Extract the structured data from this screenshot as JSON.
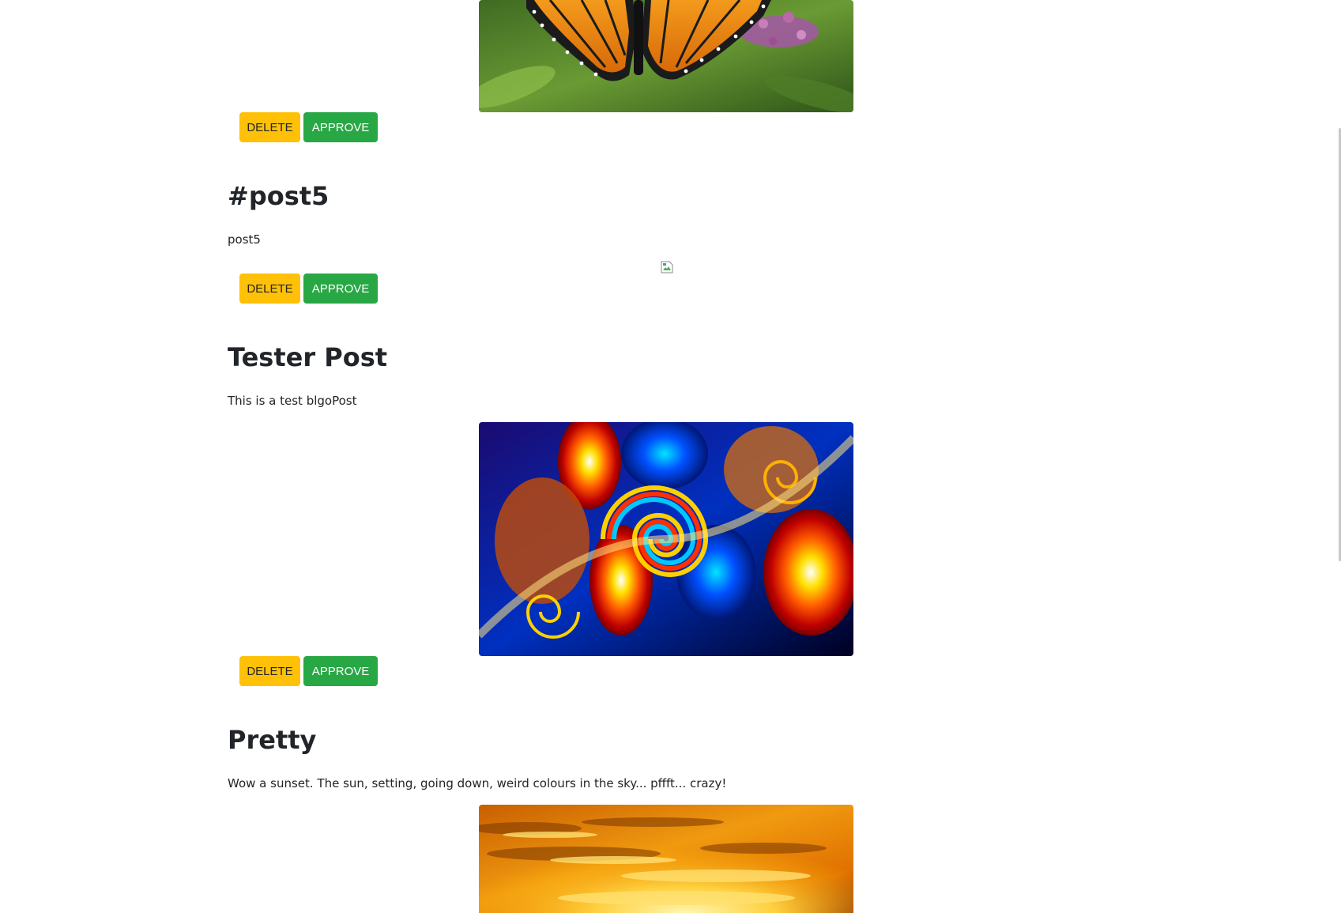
{
  "posts": [
    {
      "title": "",
      "body": "",
      "image": "butterfly-photo",
      "delete_label": "DELETE",
      "approve_label": "APPROVE"
    },
    {
      "title": "#post5",
      "body": "post5",
      "image": "broken-image",
      "delete_label": "DELETE",
      "approve_label": "APPROVE"
    },
    {
      "title": "Tester Post",
      "body": "This is a test blgoPost",
      "image": "fractal-image",
      "delete_label": "DELETE",
      "approve_label": "APPROVE"
    },
    {
      "title": "Pretty",
      "body": "Wow a sunset. The sun, setting, going down, weird colours in the sky... pffft... crazy!",
      "image": "sunset-photo"
    }
  ],
  "colors": {
    "delete_button": "#ffc107",
    "approve_button": "#28a745",
    "text": "#212529"
  }
}
